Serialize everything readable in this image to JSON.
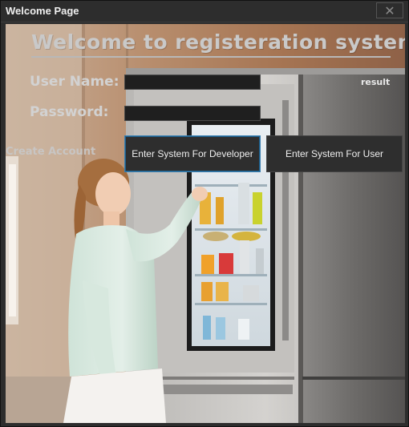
{
  "window": {
    "title": "Welcome Page",
    "close_glyph": "✕"
  },
  "form": {
    "heading": "Welcome to registeration system",
    "username_label": "User Name:",
    "password_label": "Password:",
    "username_value": "",
    "password_value": "",
    "result_text": "result",
    "create_account_label": "Create Account",
    "developer_button_label": "Enter System For Developer",
    "user_button_label": "Enter System For User"
  },
  "icons": {
    "close": "close-icon"
  },
  "colors": {
    "titlebar": "#2d2d2d",
    "button_bg": "#2e2e2e",
    "button_focus_border": "#3a7fb0",
    "heading_text": "#c9c9c9"
  }
}
